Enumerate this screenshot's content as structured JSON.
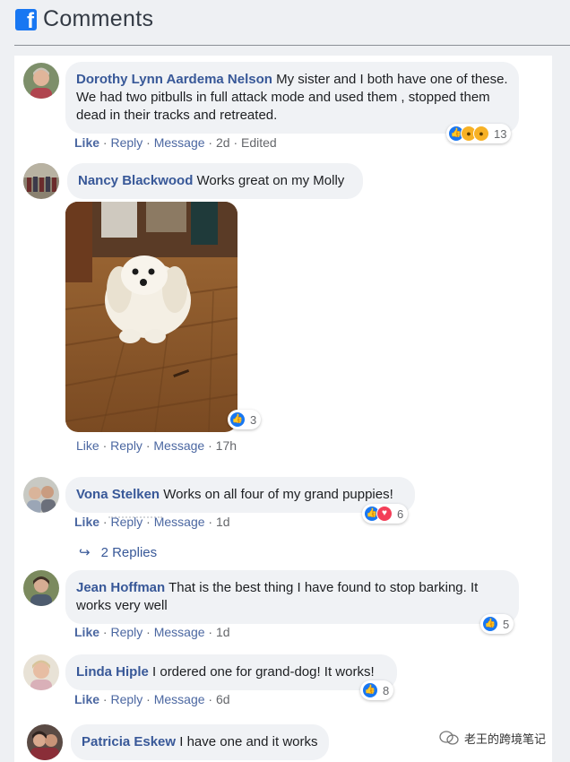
{
  "header": {
    "title": "Comments",
    "logo_letter": "f"
  },
  "comments": [
    {
      "author": "Dorothy Lynn Aardema Nelson",
      "text": " My sister and I both have one of these. We had two pitbulls in full attack mode and used them , stopped them dead in their tracks and retreated.",
      "actions": {
        "like": "Like",
        "reply": "Reply",
        "message": "Message",
        "time": "2d",
        "edited": "Edited"
      },
      "reactions": {
        "icons": [
          "like-icon",
          "wow-icon",
          "sad-icon"
        ],
        "count": "13"
      }
    },
    {
      "author": "Nancy Blackwood",
      "text": " Works great on my Molly",
      "has_photo": true,
      "actions": {
        "like": "Like",
        "reply": "Reply",
        "message": "Message",
        "time": "17h"
      },
      "reactions": {
        "icons": [
          "like-icon"
        ],
        "count": "3"
      }
    },
    {
      "author": "Vona Stelken",
      "text": " Works on all four of my grand puppies!",
      "actions": {
        "like": "Like",
        "reply": "Reply",
        "message": "Message",
        "time": "1d"
      },
      "reactions": {
        "icons": [
          "like-icon",
          "love-icon"
        ],
        "count": "6"
      },
      "replies_label": "2 Replies"
    },
    {
      "author": "Jean Hoffman",
      "text": " That is the best thing I have found to stop barking. It works very well",
      "actions": {
        "like": "Like",
        "reply": "Reply",
        "message": "Message",
        "time": "1d"
      },
      "reactions": {
        "icons": [
          "like-icon"
        ],
        "count": "5"
      }
    },
    {
      "author": "Linda Hiple",
      "text": " I ordered one for grand-dog! It works!",
      "actions": {
        "like": "Like",
        "reply": "Reply",
        "message": "Message",
        "time": "6d"
      },
      "reactions": {
        "icons": [
          "like-icon"
        ],
        "count": "8"
      }
    },
    {
      "author": "Patricia Eskew",
      "text": " I have one and it works"
    }
  ],
  "watermark": {
    "text": "老王的跨境笔记"
  },
  "colors": {
    "author": "#385898",
    "like": "#1877f2",
    "love": "#f33e58",
    "bubble": "#f0f2f5"
  }
}
